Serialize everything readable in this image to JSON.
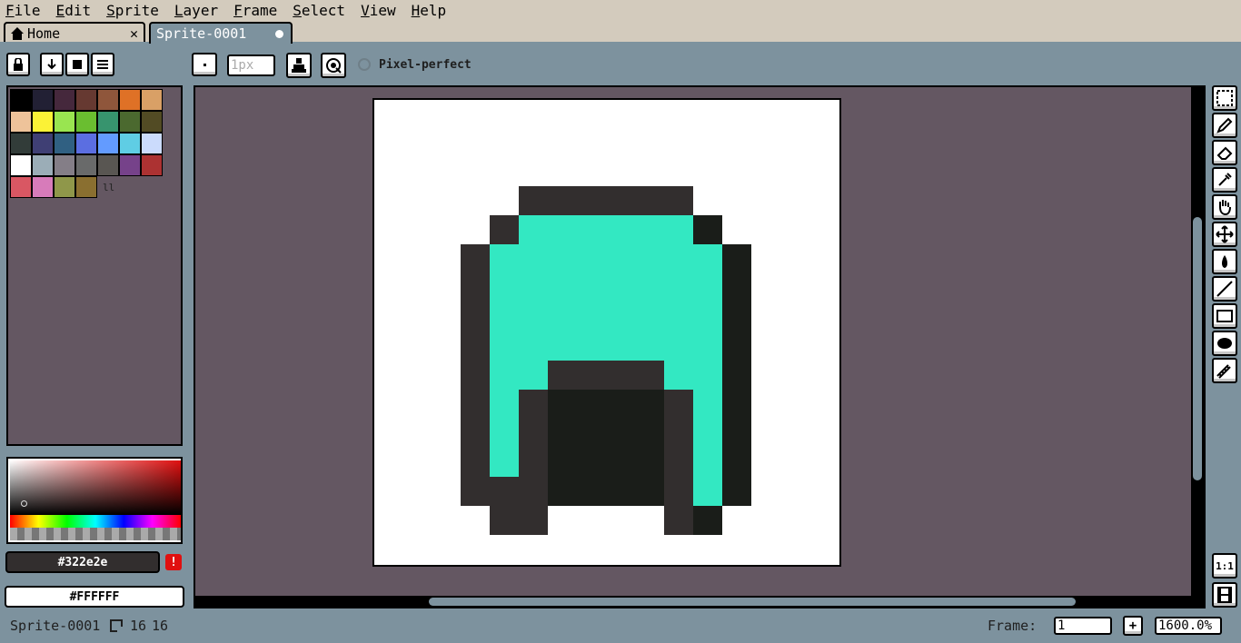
{
  "menubar": {
    "items": [
      {
        "first": "F",
        "rest": "ile"
      },
      {
        "first": "E",
        "rest": "dit"
      },
      {
        "first": "S",
        "rest": "prite"
      },
      {
        "first": "L",
        "rest": "ayer"
      },
      {
        "first": "F",
        "rest": "rame"
      },
      {
        "first": "S",
        "rest": "elect"
      },
      {
        "first": "V",
        "rest": "iew"
      },
      {
        "first": "H",
        "rest": "elp"
      }
    ]
  },
  "tabs": {
    "home_label": "Home",
    "home_close": "✕",
    "sprite_label": "Sprite-0001"
  },
  "toolbar": {
    "brush_size": "1px",
    "pixel_perfect_label": "Pixel-perfect"
  },
  "palette": {
    "colors": [
      "#000000",
      "#222034",
      "#45283c",
      "#663931",
      "#8f563b",
      "#df7126",
      "#d9a066",
      "#eec39a",
      "#fbf236",
      "#99e550",
      "#6abe30",
      "#37946e",
      "#4b692f",
      "#524b24",
      "#323c39",
      "#3f3f74",
      "#306082",
      "#5b6ee1",
      "#639bff",
      "#5fcde4",
      "#cbdbfc",
      "#ffffff",
      "#9badb7",
      "#847e87",
      "#696a6a",
      "#595652",
      "#76428a",
      "#ac3232",
      "#d95763",
      "#d77bba",
      "#8f974a",
      "#8a6f30"
    ],
    "resize_handle": "ll"
  },
  "colors": {
    "foreground_hex": "#322e2e",
    "background_hex": "#FFFFFF",
    "warning": "!"
  },
  "sprite": {
    "pixel_colors": {
      "t": "#33e8c2",
      "d": "#322e2e",
      "k": "#1a1d19"
    },
    "rows": [
      "................",
      "................",
      "................",
      ".....dddddd.....",
      "....dttttttk....",
      "...dttttttttk...",
      "...dttttttttk...",
      "...dttttttttk...",
      "...dttttttttk...",
      "...dttddddttk...",
      "...dtdkkkkdtk...",
      "...dtdkkkkdtk...",
      "...dtdkkkkdtk...",
      "...dddkkkkdtk...",
      "....dd....dk....",
      "................"
    ]
  },
  "tools": [
    "marquee-icon",
    "pencil-icon",
    "eraser-icon",
    "eyedropper-icon",
    "hand-icon",
    "move-icon",
    "paint-bucket-icon",
    "line-icon",
    "rectangle-icon",
    "ellipse-icon",
    "blur-icon"
  ],
  "status": {
    "sprite_name": "Sprite-0001",
    "width": "16",
    "height": "16",
    "frame_label": "Frame:",
    "frame_value": "1",
    "zoom": "1600.0%"
  }
}
